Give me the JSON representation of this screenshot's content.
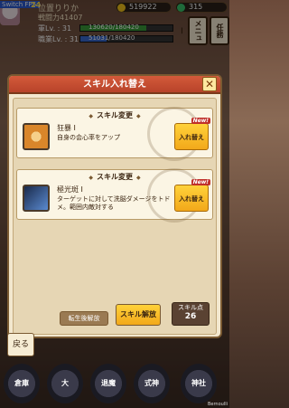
{
  "hud": {
    "fps_label": "Switch FPS:",
    "fps_value": "24",
    "player_name": "位置りりか",
    "combat_power": "戦闘力41407",
    "stats": [
      {
        "label": "軍Lv. : 31",
        "value": "130620/180420",
        "progress": 0.72,
        "color": "#3a9a3a"
      },
      {
        "label": "職業Lv. : 31",
        "value": "51031/180420",
        "progress": 0.28,
        "color": "#3a6ad0"
      }
    ],
    "currency_1": "519922",
    "currency_2": "315",
    "menu_button": "メニュー",
    "quest_button": "任務"
  },
  "dialog": {
    "title": "スキル入れ替え",
    "cards": [
      {
        "section": "スキル変更",
        "skill_name": "狂暴 I",
        "description": "自身の会心率をアップ",
        "swap_label": "入れ替え",
        "new_badge": "New!",
        "icon_color": "#d9862a"
      },
      {
        "section": "スキル変更",
        "skill_name": "極光斑 I",
        "description": "ターゲットに対して洗脳ダメージをトドメ。範囲内敵対する",
        "swap_label": "入れ替え",
        "new_badge": "New!",
        "icon_color": "#2a4a7a"
      }
    ],
    "back_label": "戻る",
    "release_after_label": "転生後解放",
    "release_label": "スキル解放",
    "skill_points_label": "スキル点",
    "skill_points_value": "26"
  },
  "bottom_menu": {
    "items": [
      "倉庫",
      "大",
      "退魔",
      "式神",
      "神社"
    ]
  },
  "watermark": "Bernoulli"
}
